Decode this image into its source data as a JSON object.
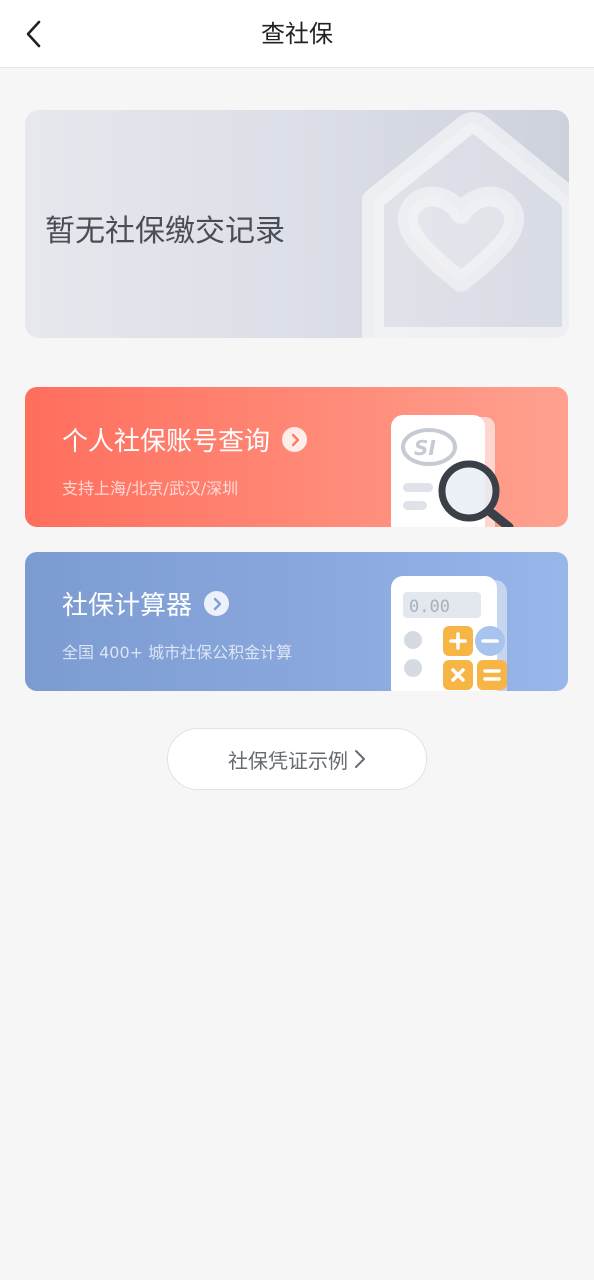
{
  "header": {
    "title": "查社保",
    "back_icon": "chevron-left-icon"
  },
  "banner": {
    "text": "暂无社保缴交记录",
    "deco_icon": "house-heart-icon"
  },
  "cards": [
    {
      "title": "个人社保账号查询",
      "subtitle": "支持上海/北京/武汉/深圳",
      "icon": "si-card-magnifier-icon",
      "badge_text": "SI",
      "color": "#ff7565"
    },
    {
      "title": "社保计算器",
      "subtitle": "全国 400+ 城市社保公积金计算",
      "icon": "calculator-icon",
      "display_text": "0.00",
      "color": "#84a3da"
    }
  ],
  "example_button": {
    "label": "社保凭证示例",
    "icon": "chevron-right-icon"
  }
}
